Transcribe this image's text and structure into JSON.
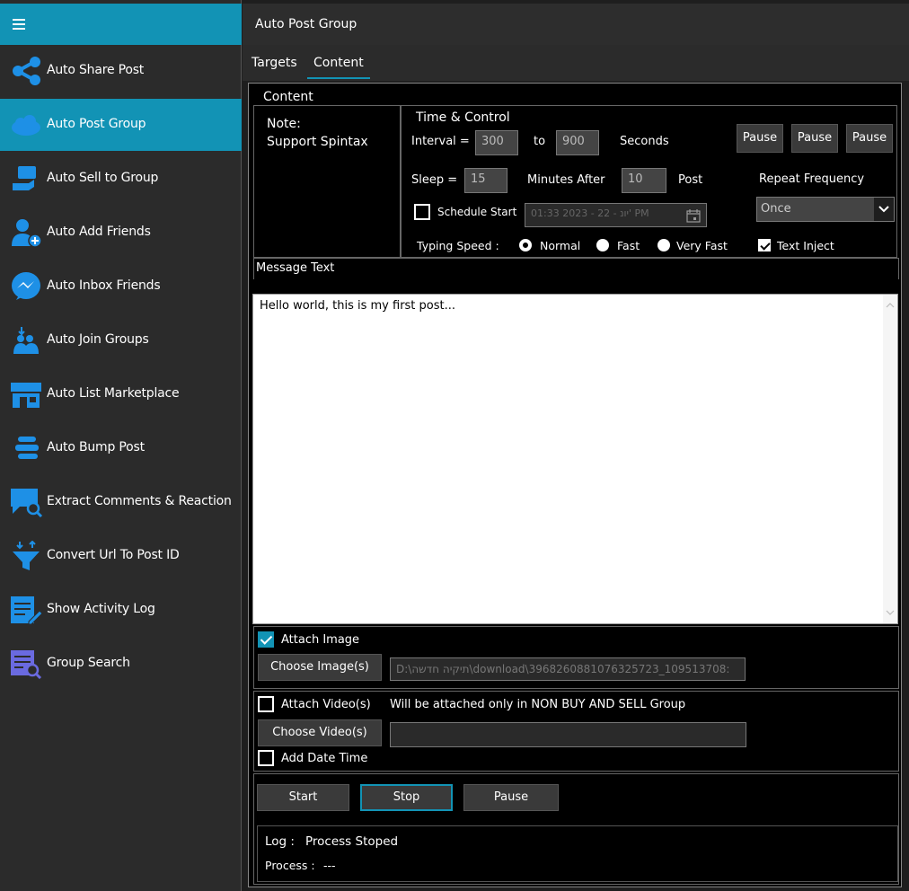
{
  "sidebar": {
    "items": [
      {
        "label": "Auto Share Post",
        "icon": "share-icon"
      },
      {
        "label": "Auto Post Group",
        "icon": "cloud-group-icon"
      },
      {
        "label": "Auto Sell to Group",
        "icon": "sell-icon"
      },
      {
        "label": "Auto Add Friends",
        "icon": "add-friend-icon"
      },
      {
        "label": "Auto Inbox Friends",
        "icon": "messenger-icon"
      },
      {
        "label": "Auto Join Groups",
        "icon": "join-group-icon"
      },
      {
        "label": "Auto List Marketplace",
        "icon": "store-icon"
      },
      {
        "label": "Auto Bump Post",
        "icon": "bump-icon"
      },
      {
        "label": "Extract Comments & Reaction",
        "icon": "comment-search-icon"
      },
      {
        "label": "Convert Url To Post ID",
        "icon": "funnel-icon"
      },
      {
        "label": "Show Activity Log",
        "icon": "activity-log-icon"
      },
      {
        "label": "Group Search",
        "icon": "group-search-icon"
      }
    ],
    "active_index": 1
  },
  "header": {
    "title": "Auto Post Group"
  },
  "tabs": [
    {
      "label": "Targets"
    },
    {
      "label": "Content"
    }
  ],
  "content": {
    "section_title": "Content",
    "note_label": "Note:",
    "note_text": "Support Spintax",
    "time_control": {
      "title": "Time & Control",
      "interval_label": "Interval =",
      "interval_from": "300",
      "to_label": "to",
      "interval_to": "900",
      "seconds_label": "Seconds",
      "sleep_label": "Sleep =",
      "sleep_value": "15",
      "minutes_after_label": "Minutes After",
      "post_count": "10",
      "post_label": "Post",
      "pause_buttons": [
        "Pause",
        "Pause",
        "Pause"
      ],
      "repeat_label": "Repeat Frequency",
      "repeat_value": "Once",
      "schedule_label": "Schedule Start",
      "schedule_value": "01:33 2023 - 22 - יונ' PM",
      "typing_speed_label": "Typing Speed :",
      "speed_options": [
        "Normal",
        "Fast",
        "Very Fast"
      ],
      "text_inject_label": "Text Inject"
    },
    "message_label": "Message Text",
    "message_text": "Hello world, this is my first post...",
    "attach_image_label": "Attach Image",
    "choose_image_label": "Choose Image(s)",
    "image_path": "D:\\תיקיה חדשה\\download\\3968260881076325723_109513708:",
    "attach_video_label": "Attach Video(s)",
    "video_note": "Will be attached only in NON BUY AND SELL Group",
    "choose_video_label": "Choose Video(s)",
    "video_path": "",
    "add_datetime_label": "Add Date Time",
    "start_label": "Start",
    "stop_label": "Stop",
    "pause_label": "Pause",
    "log_label": "Log :",
    "log_value": "Process Stoped",
    "process_label": "Process :",
    "process_value": "---"
  },
  "colors": {
    "accent": "#1293b5",
    "background": "#000000",
    "sidebar": "#2b2b2b"
  }
}
